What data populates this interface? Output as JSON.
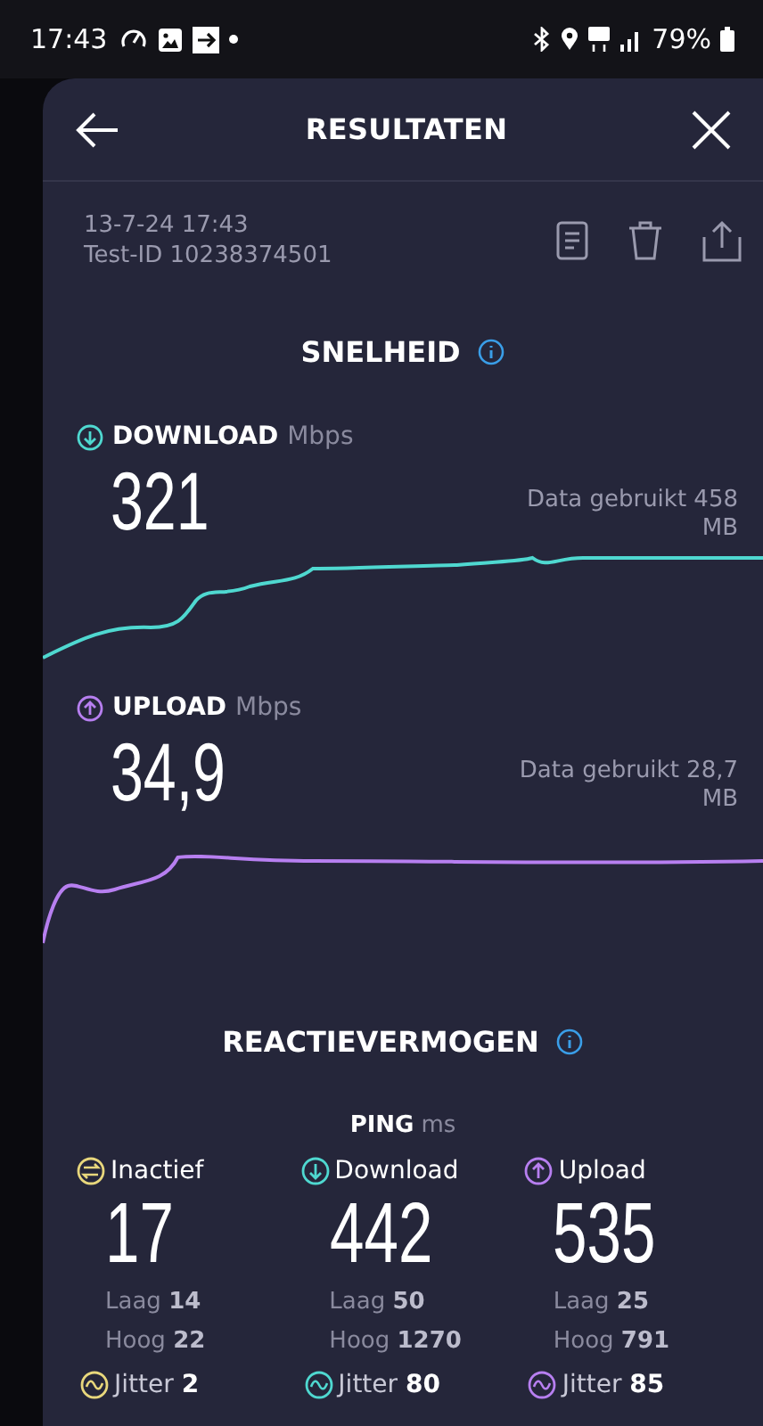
{
  "status_bar": {
    "time": "17:43",
    "battery": "79%"
  },
  "header": {
    "title": "RESULTATEN"
  },
  "meta": {
    "date": "13-7-24 17:43",
    "test_id": "Test-ID 10238374501"
  },
  "speed": {
    "title": "SNELHEID",
    "results": [
      {
        "kind": "download",
        "label": "DOWNLOAD",
        "unit": "Mbps",
        "value": "321",
        "data_used": "Data gebruikt 458 MB",
        "color": "#4fd8d0"
      },
      {
        "kind": "upload",
        "label": "UPLOAD",
        "unit": "Mbps",
        "value": "34,9",
        "data_used": "Data gebruikt 28,7 MB",
        "color": "#b77ff0"
      }
    ]
  },
  "responsiveness": {
    "title": "REACTIEVERMOGEN",
    "ping_label": "PING",
    "ping_unit": "ms",
    "columns": [
      {
        "kind": "idle",
        "label": "Inactief",
        "value": "17",
        "low": "Laag **14**",
        "high": "Hoog **22**",
        "jitter": "Jitter **2**",
        "color": "#e8d77c"
      },
      {
        "kind": "download",
        "label": "Download",
        "value": "442",
        "low": "Laag **50**",
        "high": "Hoog **1270**",
        "jitter": "Jitter **80**",
        "color": "#4fd8d0"
      },
      {
        "kind": "upload",
        "label": "Upload",
        "value": "535",
        "low": "Laag **25**",
        "high": "Hoog **791**",
        "jitter": "Jitter **85**",
        "color": "#b77ff0"
      }
    ]
  }
}
